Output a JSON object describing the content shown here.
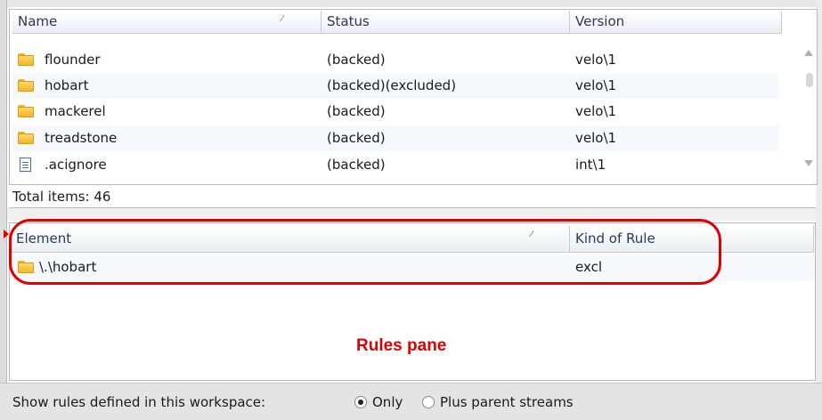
{
  "files_table": {
    "columns": [
      "Name",
      "Status",
      "Version"
    ],
    "rows": [
      {
        "icon": "folder-icon",
        "name": "flounder",
        "status": "(backed)",
        "version": "velo\\1"
      },
      {
        "icon": "folder-icon",
        "name": "hobart",
        "status": "(backed)(excluded)",
        "version": "velo\\1"
      },
      {
        "icon": "folder-icon",
        "name": "mackerel",
        "status": "(backed)",
        "version": "velo\\1"
      },
      {
        "icon": "folder-icon",
        "name": "treadstone",
        "status": "(backed)",
        "version": "velo\\1"
      },
      {
        "icon": "document-icon",
        "name": ".acignore",
        "status": "(backed)",
        "version": "int\\1"
      }
    ],
    "total_label": "Total items: 46"
  },
  "rules_table": {
    "columns": [
      "Element",
      "Kind of Rule"
    ],
    "rows": [
      {
        "icon": "folder-icon",
        "element": "\\.\\hobart",
        "kind": "excl"
      }
    ],
    "caption": "Rules pane",
    "highlight_color": "#e00000"
  },
  "bottom_bar": {
    "label": "Show rules defined in this workspace:",
    "options": [
      {
        "label": "Only",
        "selected": true
      },
      {
        "label": "Plus parent streams",
        "selected": false
      }
    ]
  }
}
